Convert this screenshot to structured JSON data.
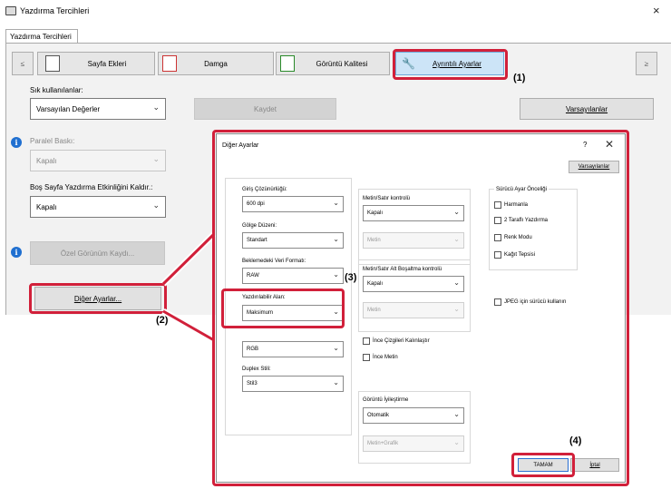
{
  "window": {
    "title": "Yazdırma Tercihleri",
    "close": "×"
  },
  "tab": {
    "label": "Yazdırma Tercihleri"
  },
  "toolbar": {
    "prev": "≤",
    "next": "≥",
    "paper_extras": "Sayfa Ekleri",
    "stamp": "Damga",
    "image_quality": "Görüntü Kalitesi",
    "advanced": "Ayrıntılı Ayarlar"
  },
  "favorites": {
    "label": "Sık kullanılanlar:",
    "value": "Varsayılan Değerler",
    "save": "Kaydet",
    "defaults": "Varsayılanlar"
  },
  "parallel": {
    "label": "Paralel Baskı:",
    "value": "Kapalı"
  },
  "blank_page": {
    "label": "Boş Sayfa Yazdırma Etkinliğini Kaldır.:",
    "value": "Kapalı"
  },
  "custom_view": {
    "label": "Özel Görünüm Kaydı..."
  },
  "other_settings": {
    "label": "Diğer Ayarlar..."
  },
  "callouts": {
    "c1": "(1)",
    "c2": "(2)",
    "c3": "(3)",
    "c4": "(4)"
  },
  "dialog": {
    "title": "Diğer Ayarlar",
    "help": "?",
    "close": "✕",
    "defaults": "Varsayılanlar",
    "input_resolution": {
      "label": "Giriş Çözünürlüğü:",
      "value": "600 dpi"
    },
    "shadow_pattern": {
      "label": "Gölge Düzeni:",
      "value": "Standart"
    },
    "spool_format": {
      "label": "Beklemedeki Veri Formatı:",
      "value": "RAW"
    },
    "printable_area": {
      "label": "Yazdırılabilir Alan:",
      "value": "Maksimum"
    },
    "color_space": {
      "value": "RGB"
    },
    "duplex_style": {
      "label": "Duplex Stili:",
      "value": "Stil3"
    },
    "text_line_control": {
      "label": "Metin/Satır kontrolü",
      "value": "Kapalı",
      "sub_value": "Metin"
    },
    "text_line_wrap": {
      "label": "Metin/Satır Alt Boşaltma kontrolü",
      "value": "Kapalı",
      "sub_value": "Metin"
    },
    "thin_lines": "İnce Çizgileri Kalınlaştır",
    "thin_text": "İnce Metin",
    "image_enhance": {
      "label": "Görüntü İyileştirme",
      "value": "Otomatik",
      "sub_value": "Metin+Grafik"
    },
    "driver_priority": {
      "label": "Sürücü Ayar Önceliği",
      "items": [
        "Harmanla",
        "2 Taraflı Yazdırma",
        "Renk Modu",
        "Kağıt Tepsisi"
      ]
    },
    "jpeg": "JPEG için sürücü kullanın",
    "ok": "TAMAM",
    "cancel": "İptal"
  }
}
